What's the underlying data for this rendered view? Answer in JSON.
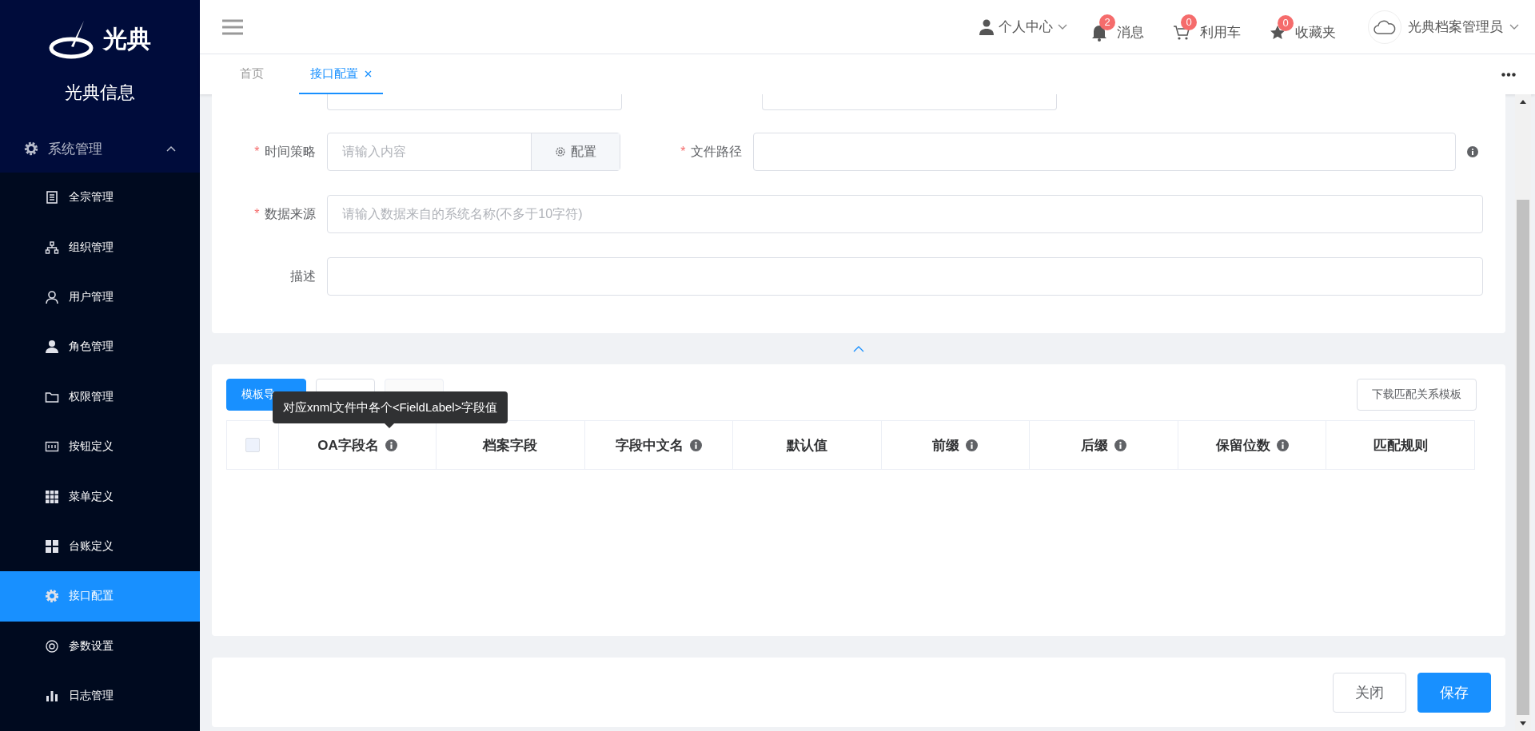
{
  "sidebar": {
    "logo_text": "光典",
    "brand": "光典信息",
    "group": {
      "label": "系统管理",
      "expanded": true
    },
    "items": [
      {
        "label": "全宗管理",
        "selected": false
      },
      {
        "label": "组织管理",
        "selected": false
      },
      {
        "label": "用户管理",
        "selected": false
      },
      {
        "label": "角色管理",
        "selected": false
      },
      {
        "label": "权限管理",
        "selected": false
      },
      {
        "label": "按钮定义",
        "selected": false
      },
      {
        "label": "菜单定义",
        "selected": false
      },
      {
        "label": "台账定义",
        "selected": false
      },
      {
        "label": "接口配置",
        "selected": true
      },
      {
        "label": "参数设置",
        "selected": false
      },
      {
        "label": "日志管理",
        "selected": false
      }
    ]
  },
  "header": {
    "user_menu": "个人中心",
    "shortcuts": [
      {
        "label": "消息",
        "count": "2"
      },
      {
        "label": "利用车",
        "count": "0"
      },
      {
        "label": "收藏夹",
        "count": "0"
      }
    ],
    "account": "光典档案管理员"
  },
  "tabs": [
    {
      "label": "首页",
      "selected": false,
      "closable": false
    },
    {
      "label": "接口配置",
      "selected": true,
      "closable": true
    }
  ],
  "form": {
    "fields": [
      {
        "label": "时间策略",
        "required_mark": "*",
        "placeholder": "请输入内容",
        "append": "配置"
      },
      {
        "label": "文件路径",
        "required_mark": "*",
        "info": true
      },
      {
        "label": "数据来源",
        "required_mark": "*",
        "placeholder": "请输入数据来自的系统名称(不多于10字符)"
      },
      {
        "label": "描述"
      }
    ]
  },
  "table": {
    "buttons": [
      {
        "label": "模板导",
        "kind": "primary"
      },
      {
        "kind": "default"
      },
      {
        "kind": "disabled"
      }
    ],
    "download": "下载匹配关系模板",
    "tooltip": "对应xnml文件中各个<FieldLabel>字段值",
    "select_all": {
      "checked": false
    },
    "columns": [
      {
        "label": "OA字段名",
        "info": true
      },
      {
        "label": "档案字段",
        "info": false
      },
      {
        "label": "字段中文名",
        "info": true
      },
      {
        "label": "默认值",
        "info": false
      },
      {
        "label": "前缀",
        "info": true
      },
      {
        "label": "后缀",
        "info": true
      },
      {
        "label": "保留位数",
        "info": true
      },
      {
        "label": "匹配规则",
        "info": false
      }
    ]
  },
  "footer": {
    "cancel": "关闭",
    "save": "保存"
  }
}
